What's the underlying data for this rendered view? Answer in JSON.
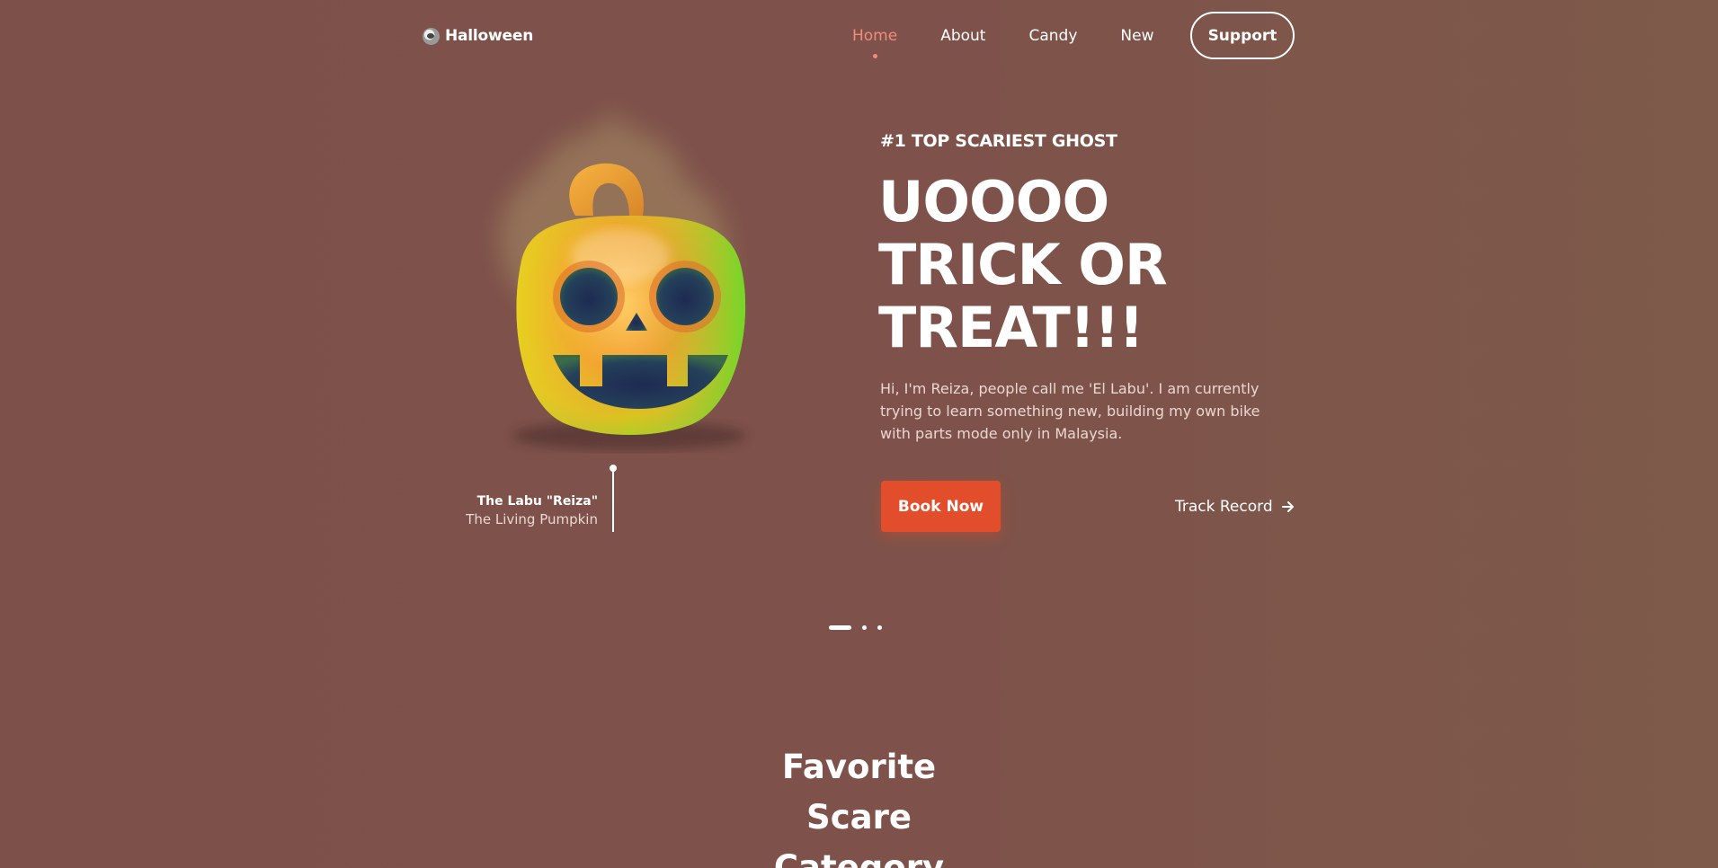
{
  "header": {
    "logo_text": "Halloween",
    "logo_icon": "ghost-icon",
    "nav": [
      "Home",
      "About",
      "Candy",
      "New"
    ],
    "active_nav": "Home",
    "support_label": "Support"
  },
  "hero": {
    "image": "jack-o-lantern-pumpkin-illustration",
    "caption_title": "The Labu \"Reiza\"",
    "caption_subtitle": "The Living Pumpkin",
    "eyebrow": "#1 TOP SCARIEST GHOST",
    "headline": [
      "UOOOO",
      "TRICK OR",
      "TREAT!!!"
    ],
    "description": "Hi, I'm Reiza, people call me 'El Labu'. I am currently trying to learn something new, building my own bike with parts mode only in Malaysia.",
    "book_label": "Book Now",
    "track_label": "Track Record",
    "track_icon": "arrow-right-icon"
  },
  "carousel": {
    "total": 3,
    "active": 1
  },
  "section": {
    "title": "Favorite Scare Category"
  },
  "colors": {
    "background": "#7e524a",
    "accent": "#e24e2b",
    "active_nav": "#f08c7c"
  }
}
